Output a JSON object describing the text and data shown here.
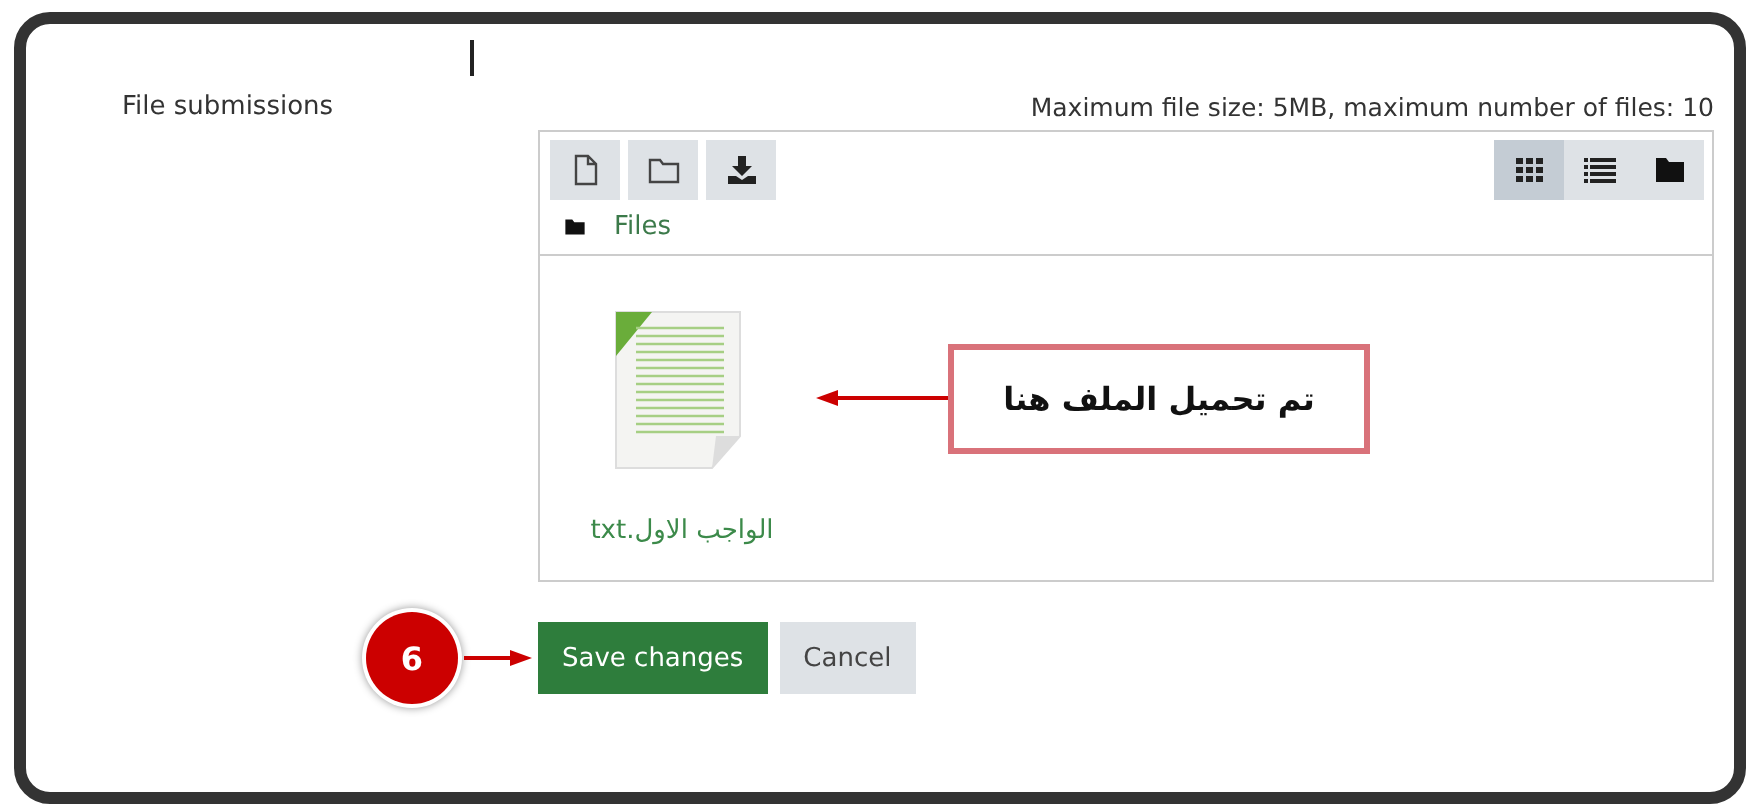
{
  "field": {
    "label": "File submissions",
    "limits": "Maximum file size: 5MB, maximum number of files: 10"
  },
  "toolbar": {
    "actions": [
      {
        "kind": "add-file"
      },
      {
        "kind": "folder"
      },
      {
        "kind": "download"
      }
    ],
    "view_modes": [
      {
        "kind": "grid",
        "selected": true
      },
      {
        "kind": "list",
        "selected": false
      },
      {
        "kind": "tree",
        "selected": false
      }
    ]
  },
  "path": "Files",
  "files": [
    {
      "name": "الواجب الاول.txt"
    }
  ],
  "callout": {
    "text": "تم تحميل الملف هنا"
  },
  "step_badge": "6",
  "buttons": [
    {
      "kind": "primary",
      "label": "Save changes"
    },
    {
      "kind": "secondary",
      "label": "Cancel"
    }
  ]
}
